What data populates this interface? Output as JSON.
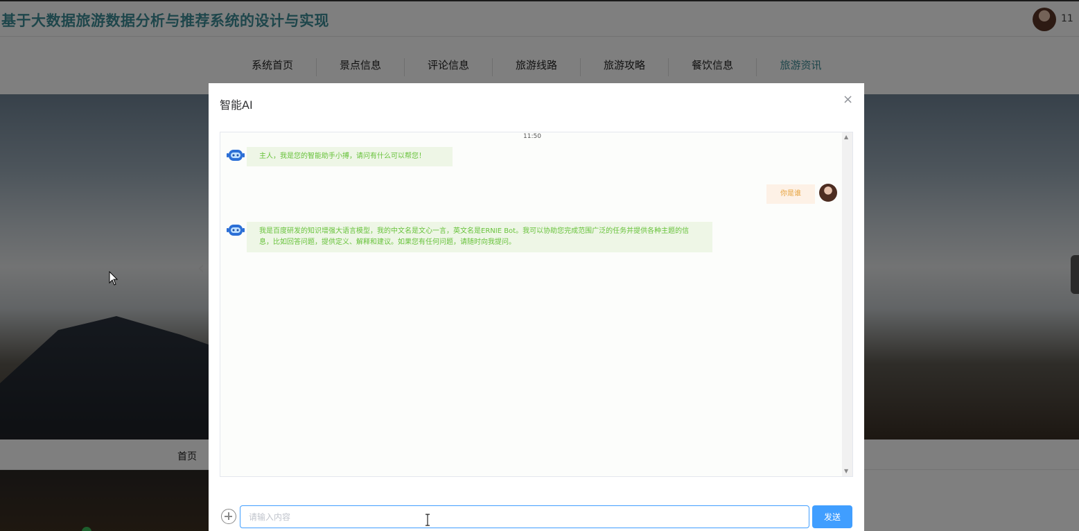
{
  "header": {
    "site_title": "基于大数据旅游数据分析与推荐系统的设计与实现",
    "user_name": "11"
  },
  "nav": {
    "items": [
      "系统首页",
      "景点信息",
      "评论信息",
      "旅游线路",
      "旅游攻略",
      "餐饮信息",
      "旅游资讯"
    ],
    "active": "旅游资讯"
  },
  "subnav": {
    "home": "首页"
  },
  "dialog": {
    "title": "智能AI",
    "close_icon": "×",
    "time": "11:50",
    "messages": [
      {
        "from": "bot",
        "text": "主人，我是您的智能助手小搏，请问有什么可以帮您！"
      },
      {
        "from": "user",
        "text": "你是谁"
      },
      {
        "from": "bot",
        "text": "我是百度研发的知识增强大语言模型，我的中文名是文心一言，英文名是ERNIE Bot。我可以协助您完成范围广泛的任务并提供各种主题的信息，比如回答问题，提供定义、解释和建议。如果您有任何问题，请随时向我提问。"
      }
    ],
    "input_placeholder": "请输入内容",
    "input_value": "",
    "send_label": "发送"
  },
  "colors": {
    "accent": "#409eff",
    "title": "#3d8c96",
    "bot_text": "#67c23a",
    "user_text": "#e6a23c"
  }
}
